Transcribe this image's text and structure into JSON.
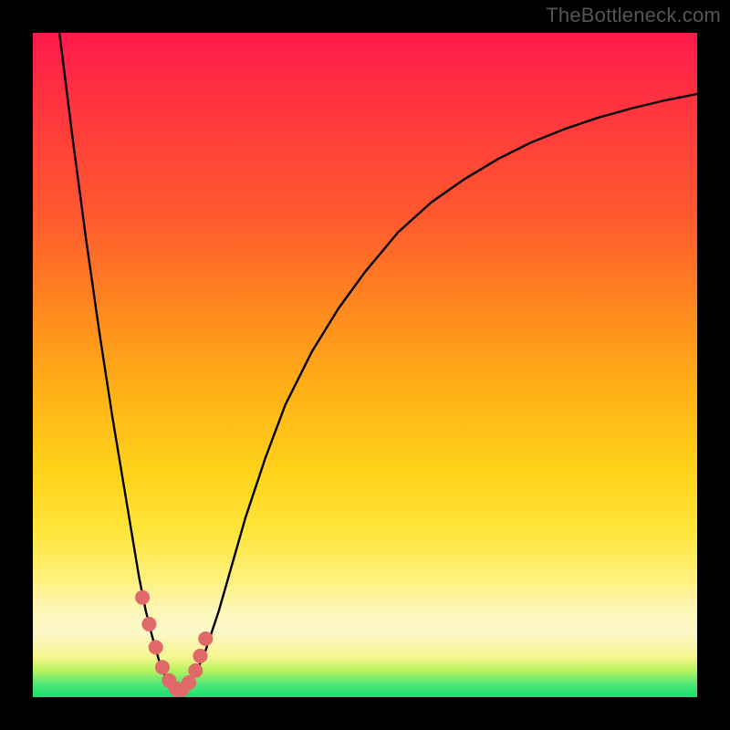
{
  "watermark": "TheBottleneck.com",
  "chart_data": {
    "type": "line",
    "title": "",
    "xlabel": "",
    "ylabel": "",
    "xlim": [
      0,
      100
    ],
    "ylim": [
      0,
      100
    ],
    "grid": false,
    "legend": false,
    "annotations": [],
    "gradient_stops": [
      {
        "pos": 0.0,
        "color": "#ff1a4d"
      },
      {
        "pos": 0.28,
        "color": "#ff5a2e"
      },
      {
        "pos": 0.55,
        "color": "#ffb416"
      },
      {
        "pos": 0.75,
        "color": "#ffe53a"
      },
      {
        "pos": 0.9,
        "color": "#fbf7c8"
      },
      {
        "pos": 0.96,
        "color": "#b8f35e"
      },
      {
        "pos": 1.0,
        "color": "#18df72"
      }
    ],
    "series": [
      {
        "name": "bottleneck-curve",
        "x": [
          4.0,
          6.0,
          8.0,
          10.0,
          12.0,
          14.0,
          15.0,
          16.0,
          17.0,
          18.0,
          19.0,
          20.0,
          21.0,
          22.0,
          23.0,
          24.5,
          26.0,
          28.0,
          30.0,
          32.0,
          35.0,
          38.0,
          42.0,
          46.0,
          50.0,
          55.0,
          60.0,
          65.0,
          70.0,
          75.0,
          80.0,
          85.0,
          90.0,
          95.0,
          100.0
        ],
        "values": [
          100.0,
          84.0,
          69.0,
          55.0,
          42.0,
          30.0,
          24.0,
          18.0,
          13.0,
          9.0,
          5.5,
          3.0,
          1.5,
          1.0,
          1.5,
          3.5,
          7.0,
          13.0,
          20.0,
          27.0,
          36.0,
          44.0,
          52.0,
          58.5,
          64.0,
          70.0,
          74.5,
          78.0,
          81.0,
          83.5,
          85.5,
          87.2,
          88.6,
          89.8,
          90.8
        ]
      }
    ],
    "markers": {
      "name": "highlight-dots",
      "color": "#e06a6a",
      "x": [
        16.5,
        17.5,
        18.5,
        19.5,
        20.5,
        21.5,
        22.0,
        22.5,
        23.5,
        24.5,
        25.2,
        26.0
      ],
      "values": [
        15.0,
        11.0,
        7.5,
        4.5,
        2.5,
        1.3,
        1.0,
        1.2,
        2.2,
        4.0,
        6.2,
        8.8
      ]
    }
  }
}
